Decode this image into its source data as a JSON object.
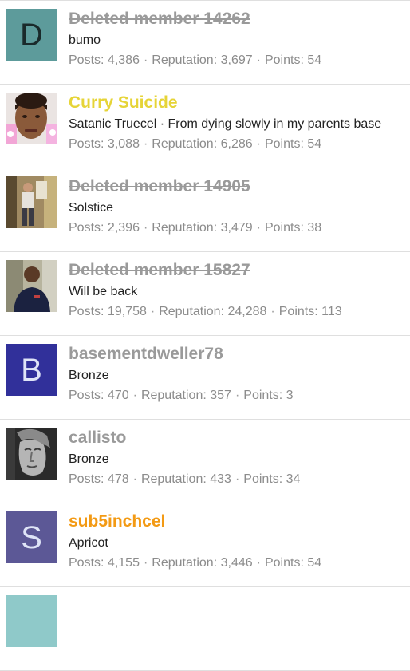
{
  "colors": {
    "deleted_name": "#9a9a9a",
    "normal_name": "#9a9a9a",
    "gold_name": "#e6d437",
    "orange_name": "#f39a14",
    "avatar_teal": "#5d9b9b",
    "avatar_navy": "#31309a",
    "avatar_slate": "#5c5896"
  },
  "members": [
    {
      "name": "Deleted member 14262",
      "deleted": true,
      "name_color": "#9a9a9a",
      "title": "bumo",
      "avatar": {
        "type": "letter",
        "letter": "D",
        "bg": "#5d9b9b",
        "icon": "letter-avatar"
      },
      "stats": {
        "posts_label": "Posts:",
        "posts": "4,386",
        "rep_label": "Reputation:",
        "rep": "3,697",
        "points_label": "Points:",
        "points": "54"
      }
    },
    {
      "name": "Curry Suicide",
      "deleted": false,
      "name_color": "#e6d437",
      "title": "Satanic Truecel · From dying slowly in my parents base",
      "avatar": {
        "type": "photo",
        "icon": "face-photo-avatar"
      },
      "stats": {
        "posts_label": "Posts:",
        "posts": "3,088",
        "rep_label": "Reputation:",
        "rep": "6,286",
        "points_label": "Points:",
        "points": "54"
      }
    },
    {
      "name": "Deleted member 14905",
      "deleted": true,
      "name_color": "#9a9a9a",
      "title": "Solstice",
      "avatar": {
        "type": "photo",
        "icon": "person-photo-avatar"
      },
      "stats": {
        "posts_label": "Posts:",
        "posts": "2,396",
        "rep_label": "Reputation:",
        "rep": "3,479",
        "points_label": "Points:",
        "points": "38"
      }
    },
    {
      "name": "Deleted member 15827",
      "deleted": true,
      "name_color": "#9a9a9a",
      "title": "Will be back",
      "avatar": {
        "type": "photo",
        "icon": "person-photo-avatar"
      },
      "stats": {
        "posts_label": "Posts:",
        "posts": "19,758",
        "rep_label": "Reputation:",
        "rep": "24,288",
        "points_label": "Points:",
        "points": "113"
      }
    },
    {
      "name": "basementdweller78",
      "deleted": false,
      "name_color": "#9a9a9a",
      "title": "Bronze",
      "avatar": {
        "type": "letter",
        "letter": "B",
        "bg": "#31309a",
        "icon": "letter-avatar"
      },
      "stats": {
        "posts_label": "Posts:",
        "posts": "470",
        "rep_label": "Reputation:",
        "rep": "357",
        "points_label": "Points:",
        "points": "3"
      }
    },
    {
      "name": "callisto",
      "deleted": false,
      "name_color": "#9a9a9a",
      "title": "Bronze",
      "avatar": {
        "type": "photo",
        "icon": "statue-photo-avatar"
      },
      "stats": {
        "posts_label": "Posts:",
        "posts": "478",
        "rep_label": "Reputation:",
        "rep": "433",
        "points_label": "Points:",
        "points": "34"
      }
    },
    {
      "name": "sub5inchcel",
      "deleted": false,
      "name_color": "#f39a14",
      "title": "Apricot",
      "avatar": {
        "type": "letter",
        "letter": "S",
        "bg": "#5c5896",
        "icon": "letter-avatar"
      },
      "stats": {
        "posts_label": "Posts:",
        "posts": "4,155",
        "rep_label": "Reputation:",
        "rep": "3,446",
        "points_label": "Points:",
        "points": "54"
      }
    }
  ]
}
